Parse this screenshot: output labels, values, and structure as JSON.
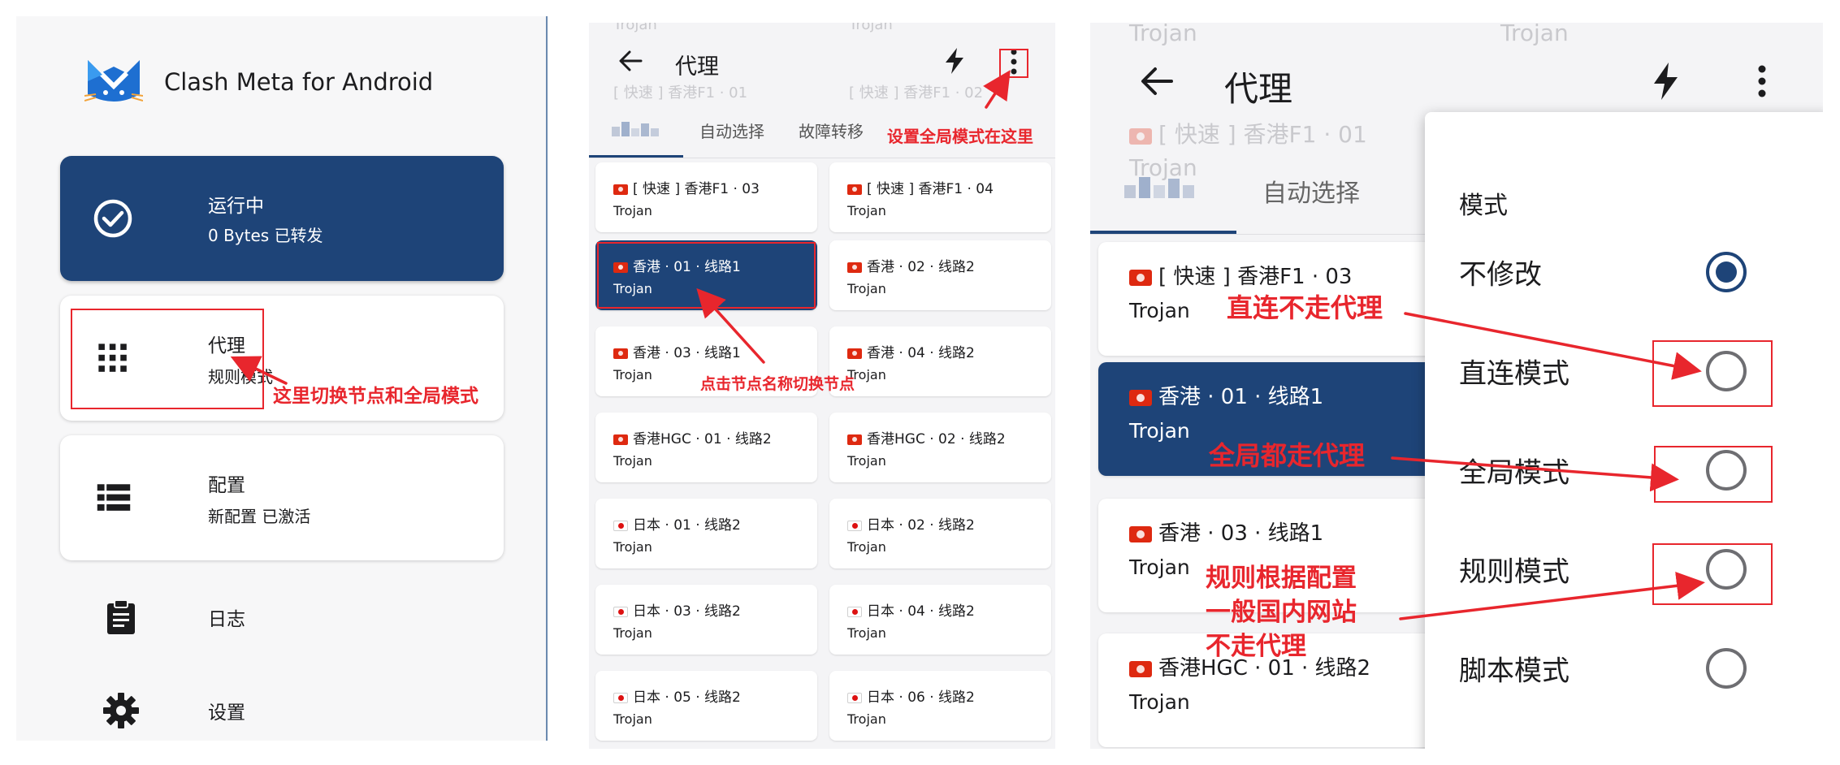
{
  "colors": {
    "accent": "#1e4478",
    "annotation": "#e8262d"
  },
  "panel1": {
    "app_title": "Clash Meta for Android",
    "status_card": {
      "title": "运行中",
      "subtitle": "0 Bytes 已转发",
      "icon": "check-circle-icon"
    },
    "proxy_card": {
      "title": "代理",
      "subtitle": "规则模式",
      "icon": "grid-icon"
    },
    "profile_card": {
      "title": "配置",
      "subtitle": "新配置 已激活",
      "icon": "list-icon"
    },
    "logs": {
      "label": "日志",
      "icon": "clipboard-icon"
    },
    "settings": {
      "label": "设置",
      "icon": "gear-icon"
    },
    "annotation": "这里切换节点和全局模式"
  },
  "panel2": {
    "title": "代理",
    "tabs": [
      "自动选择",
      "故障转移"
    ],
    "ghost": [
      "Trojan",
      "Trojan",
      "[ 快速 ] 香港F1 · 01",
      "[ 快速 ] 香港F1 · 02"
    ],
    "nodes": [
      {
        "name": "[ 快速 ] 香港F1 · 03",
        "type": "Trojan",
        "flag": "hk"
      },
      {
        "name": "[ 快速 ] 香港F1 · 04",
        "type": "Trojan",
        "flag": "hk"
      },
      {
        "name": "香港 · 01 · 线路1",
        "type": "Trojan",
        "flag": "hk",
        "selected": true
      },
      {
        "name": "香港 · 02 · 线路2",
        "type": "Trojan",
        "flag": "hk"
      },
      {
        "name": "香港 · 03 · 线路1",
        "type": "Trojan",
        "flag": "hk"
      },
      {
        "name": "香港 · 04 · 线路2",
        "type": "Trojan",
        "flag": "hk"
      },
      {
        "name": "香港HGC · 01 · 线路2",
        "type": "Trojan",
        "flag": "hk"
      },
      {
        "name": "香港HGC · 02 · 线路2",
        "type": "Trojan",
        "flag": "hk"
      },
      {
        "name": "日本 · 01 · 线路2",
        "type": "Trojan",
        "flag": "jp"
      },
      {
        "name": "日本 · 02 · 线路2",
        "type": "Trojan",
        "flag": "jp"
      },
      {
        "name": "日本 · 03 · 线路2",
        "type": "Trojan",
        "flag": "jp"
      },
      {
        "name": "日本 · 04 · 线路2",
        "type": "Trojan",
        "flag": "jp"
      },
      {
        "name": "日本 · 05 · 线路2",
        "type": "Trojan",
        "flag": "jp"
      },
      {
        "name": "日本 · 06 · 线路2",
        "type": "Trojan",
        "flag": "jp"
      }
    ],
    "annotations": {
      "menu": "设置全局模式在这里",
      "node": "点击节点名称切换节点"
    }
  },
  "panel3": {
    "title": "代理",
    "tabs": [
      "自动选择"
    ],
    "ghost": [
      "Trojan",
      "Trojan",
      "[ 快速 ] 香港F1 · 01",
      "Trojan"
    ],
    "nodes": [
      {
        "name": "[ 快速 ] 香港F1 · 03",
        "type": "Trojan"
      },
      {
        "name": "香港 · 01 · 线路1",
        "type": "Trojan",
        "selected": true
      },
      {
        "name": "香港 · 03 · 线路1",
        "type": "Trojan"
      },
      {
        "name": "香港HGC · 01 · 线路2",
        "type": "Trojan"
      }
    ],
    "menu": {
      "header": "模式",
      "options": [
        {
          "label": "不修改",
          "checked": true
        },
        {
          "label": "直连模式",
          "checked": false
        },
        {
          "label": "全局模式",
          "checked": false
        },
        {
          "label": "规则模式",
          "checked": false
        },
        {
          "label": "脚本模式",
          "checked": false
        }
      ]
    },
    "annotations": {
      "direct": "直连不走代理",
      "global": "全局都走代理",
      "rule_1": "规则根据配置",
      "rule_2": "一般国内网站",
      "rule_3": "不走代理"
    }
  }
}
